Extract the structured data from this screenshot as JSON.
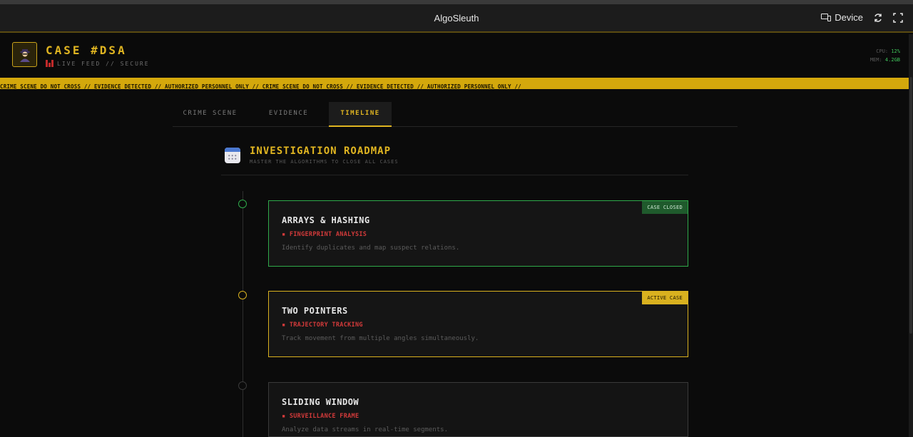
{
  "window": {
    "title": "AlgoSleuth",
    "device_label": "Device"
  },
  "header": {
    "case_title": "CASE #DSA",
    "subtitle": "LIVE FEED // SECURE",
    "stats": {
      "cpu_label": "CPU:",
      "cpu_value": "12%",
      "mem_label": "MEM:",
      "mem_value": "4.2GB"
    }
  },
  "tape": {
    "text": "CRIME SCENE DO NOT CROSS // EVIDENCE DETECTED // AUTHORIZED PERSONNEL ONLY // CRIME SCENE DO NOT CROSS // EVIDENCE DETECTED // AUTHORIZED PERSONNEL ONLY //"
  },
  "tabs": [
    {
      "label": "CRIME SCENE",
      "active": false
    },
    {
      "label": "EVIDENCE",
      "active": false
    },
    {
      "label": "TIMELINE",
      "active": true
    }
  ],
  "roadmap": {
    "title": "INVESTIGATION ROADMAP",
    "subtitle": "MASTER THE ALGORITHMS TO CLOSE ALL CASES",
    "cases": [
      {
        "title": "ARRAYS & HASHING",
        "tag": "FINGERPRINT ANALYSIS",
        "description": "Identify duplicates and map suspect relations.",
        "status": "CASE CLOSED",
        "state": "closed",
        "color": "#2faa4a"
      },
      {
        "title": "TWO POINTERS",
        "tag": "TRAJECTORY TRACKING",
        "description": "Track movement from multiple angles simultaneously.",
        "status": "ACTIVE CASE",
        "state": "active",
        "color": "#d9b11f"
      },
      {
        "title": "SLIDING WINDOW",
        "tag": "SURVEILLANCE FRAME",
        "description": "Analyze data streams in real-time segments.",
        "status": "",
        "state": "locked",
        "color": "#3a3a3a"
      }
    ]
  }
}
